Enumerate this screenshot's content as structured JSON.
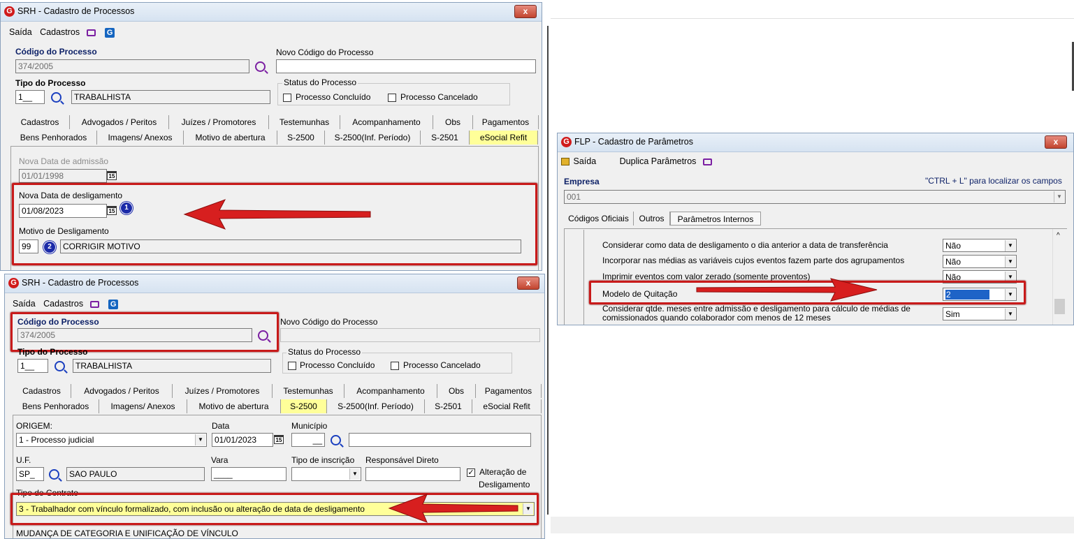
{
  "colors": {
    "highlight": "#ffff99",
    "annotation_red": "#c81a1a",
    "badge_blue": "#1b2aa8",
    "icon_purple": "#7b1fa2"
  },
  "win1": {
    "title": "SRH - Cadastro de Processos",
    "close": "x",
    "menu": {
      "saida": "Saída",
      "cadastros": "Cadastros"
    },
    "codigo_label": "Código do Processo",
    "codigo_value": "374/2005",
    "novo_codigo_label": "Novo Código do Processo",
    "novo_codigo_value": "",
    "tipo_label": "Tipo do Processo",
    "tipo_code": "1__",
    "tipo_value": "TRABALHISTA",
    "status_title": "Status do Processo",
    "concluido": "Processo Concluído",
    "cancelado": "Processo Cancelado",
    "tabs_row1": [
      "Cadastros",
      "Advogados / Peritos",
      "Juízes / Promotores",
      "Testemunhas",
      "Acompanhamento",
      "Obs",
      "Pagamentos"
    ],
    "tabs_row2": [
      "Bens Penhorados",
      "Imagens/ Anexos",
      "Motivo de abertura",
      "S-2500",
      "S-2500(Inf. Período)",
      "S-2501",
      "eSocial Refit"
    ],
    "admissao_label": "Nova Data de admissão",
    "admissao_value": "01/01/1998",
    "deslig_label": "Nova Data de desligamento",
    "deslig_value": "01/08/2023",
    "motivo_label": "Motivo de Desligamento",
    "motivo_code": "99",
    "motivo_value": "CORRIGIR MOTIVO",
    "badge1": "1",
    "badge2": "2",
    "cal": "15"
  },
  "win2": {
    "title": "SRH - Cadastro de Processos",
    "close": "x",
    "menu": {
      "saida": "Saída",
      "cadastros": "Cadastros"
    },
    "codigo_label": "Código do Processo",
    "codigo_value": "374/2005",
    "novo_codigo_label": "Novo Código do Processo",
    "tipo_label": "Tipo do Processo",
    "tipo_code": "1__",
    "tipo_value": "TRABALHISTA",
    "status_title": "Status do Processo",
    "concluido": "Processo Concluído",
    "cancelado": "Processo Cancelado",
    "tabs_row1": [
      "Cadastros",
      "Advogados / Peritos",
      "Juízes / Promotores",
      "Testemunhas",
      "Acompanhamento",
      "Obs",
      "Pagamentos"
    ],
    "tabs_row2": [
      "Bens Penhorados",
      "Imagens/ Anexos",
      "Motivo de abertura",
      "S-2500",
      "S-2500(Inf. Período)",
      "S-2501",
      "eSocial Refit"
    ],
    "origem_label": "ORIGEM:",
    "origem_value": "1 - Processo judicial",
    "data_label": "Data",
    "data_value": "01/01/2023",
    "municipio_label": "Município",
    "municipio_code": "__",
    "uf_label": "U.F.",
    "uf_code": "SP_",
    "uf_value": "SAO PAULO",
    "vara_label": "Vara",
    "vara_value": "____",
    "tipo_inscricao_label": "Tipo de inscrição",
    "responsavel_label": "Responsável Direto",
    "alteracao_label1": "Alteração de",
    "alteracao_label2": "Desligamento",
    "contrato_label": "Tipo de Contrato",
    "contrato_value": "3 - Trabalhador com vínculo formalizado, com inclusão ou alteração de data de desligamento",
    "mudanca_label": "MUDANÇA DE CATEGORIA E UNIFICAÇÃO DE VÍNCULO",
    "cal": "15"
  },
  "win3": {
    "title": "FLP - Cadastro de Parâmetros",
    "close": "x",
    "menu": {
      "saida": "Saída",
      "duplica": "Duplica Parâmetros"
    },
    "empresa_label": "Empresa",
    "empresa_value": "001",
    "ctrl_hint": "\"CTRL + L\" para localizar os campos",
    "tabs": [
      "Códigos Oficiais",
      "Outros",
      "Parâmetros Internos"
    ],
    "rows": [
      {
        "label": "Considerar como data de desligamento o dia anterior a data de transferência",
        "value": "Não"
      },
      {
        "label": "Incorporar nas médias as variáveis cujos eventos fazem parte dos agrupamentos",
        "value": "Não"
      },
      {
        "label": "Imprimir eventos com valor zerado (somente proventos)",
        "value": "Não"
      },
      {
        "label": "Modelo de Quitação",
        "value": "2"
      },
      {
        "label": "Considerar qtde. meses entre admissão e desligamento para cálculo de médias de",
        "label2": "comissionados quando colaborador com menos de 12 meses",
        "value": "Sim"
      }
    ]
  }
}
